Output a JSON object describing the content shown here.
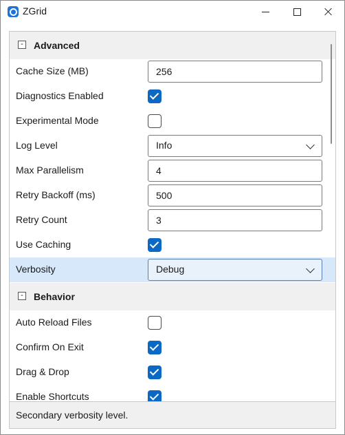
{
  "window": {
    "title": "ZGrid",
    "app_icon": "app-logo-icon",
    "controls": [
      "minimize-icon",
      "maximize-icon",
      "close-icon"
    ]
  },
  "categories": [
    {
      "label": "Advanced",
      "toggle": "-",
      "properties": [
        {
          "label": "Cache Size (MB)",
          "type": "text",
          "value": "256"
        },
        {
          "label": "Diagnostics Enabled",
          "type": "checkbox",
          "checked": true
        },
        {
          "label": "Experimental Mode",
          "type": "checkbox",
          "checked": false
        },
        {
          "label": "Log Level",
          "type": "combo",
          "value": "Info"
        },
        {
          "label": "Max Parallelism",
          "type": "text",
          "value": "4"
        },
        {
          "label": "Retry Backoff (ms)",
          "type": "text",
          "value": "500"
        },
        {
          "label": "Retry Count",
          "type": "text",
          "value": "3"
        },
        {
          "label": "Use Caching",
          "type": "checkbox",
          "checked": true
        },
        {
          "label": "Verbosity",
          "type": "combo",
          "value": "Debug",
          "selected": true
        }
      ]
    },
    {
      "label": "Behavior",
      "toggle": "-",
      "properties": [
        {
          "label": "Auto Reload Files",
          "type": "checkbox",
          "checked": false
        },
        {
          "label": "Confirm On Exit",
          "type": "checkbox",
          "checked": true
        },
        {
          "label": "Drag & Drop",
          "type": "checkbox",
          "checked": true
        },
        {
          "label": "Enable Shortcuts",
          "type": "checkbox",
          "checked": true
        }
      ]
    }
  ],
  "description": "Secondary verbosity level.",
  "colors": {
    "accent": "#0b68c4",
    "selected_row": "#d6e8fa",
    "category_bg": "#f0f0f0"
  }
}
